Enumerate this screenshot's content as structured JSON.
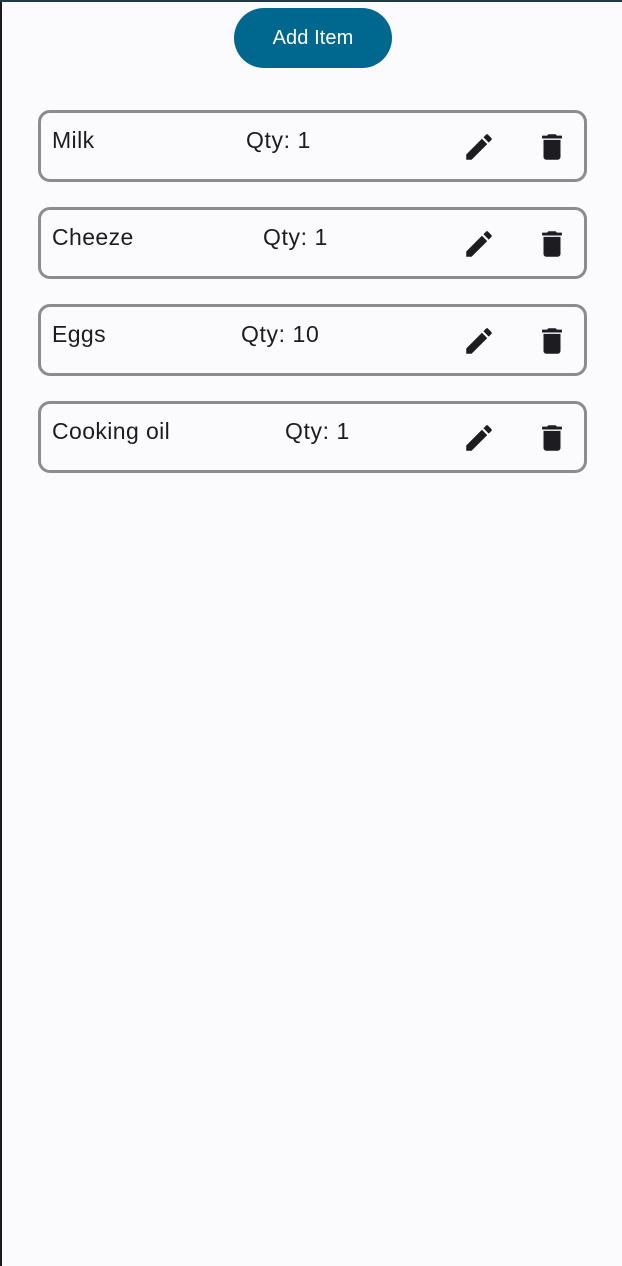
{
  "toolbar": {
    "add_label": "Add Item"
  },
  "items": [
    {
      "name": "Milk",
      "qty": "Qty: 1"
    },
    {
      "name": "Cheeze",
      "qty": "Qty: 1"
    },
    {
      "name": "Eggs",
      "qty": "Qty: 10"
    },
    {
      "name": "Cooking oil",
      "qty": "Qty: 1"
    }
  ],
  "icons": {
    "edit": "pencil-icon",
    "delete": "trash-icon"
  },
  "colors": {
    "accent": "#00688f",
    "card_border": "#8c8c8f",
    "background": "#fbfbfe",
    "text": "#1d1d21"
  }
}
